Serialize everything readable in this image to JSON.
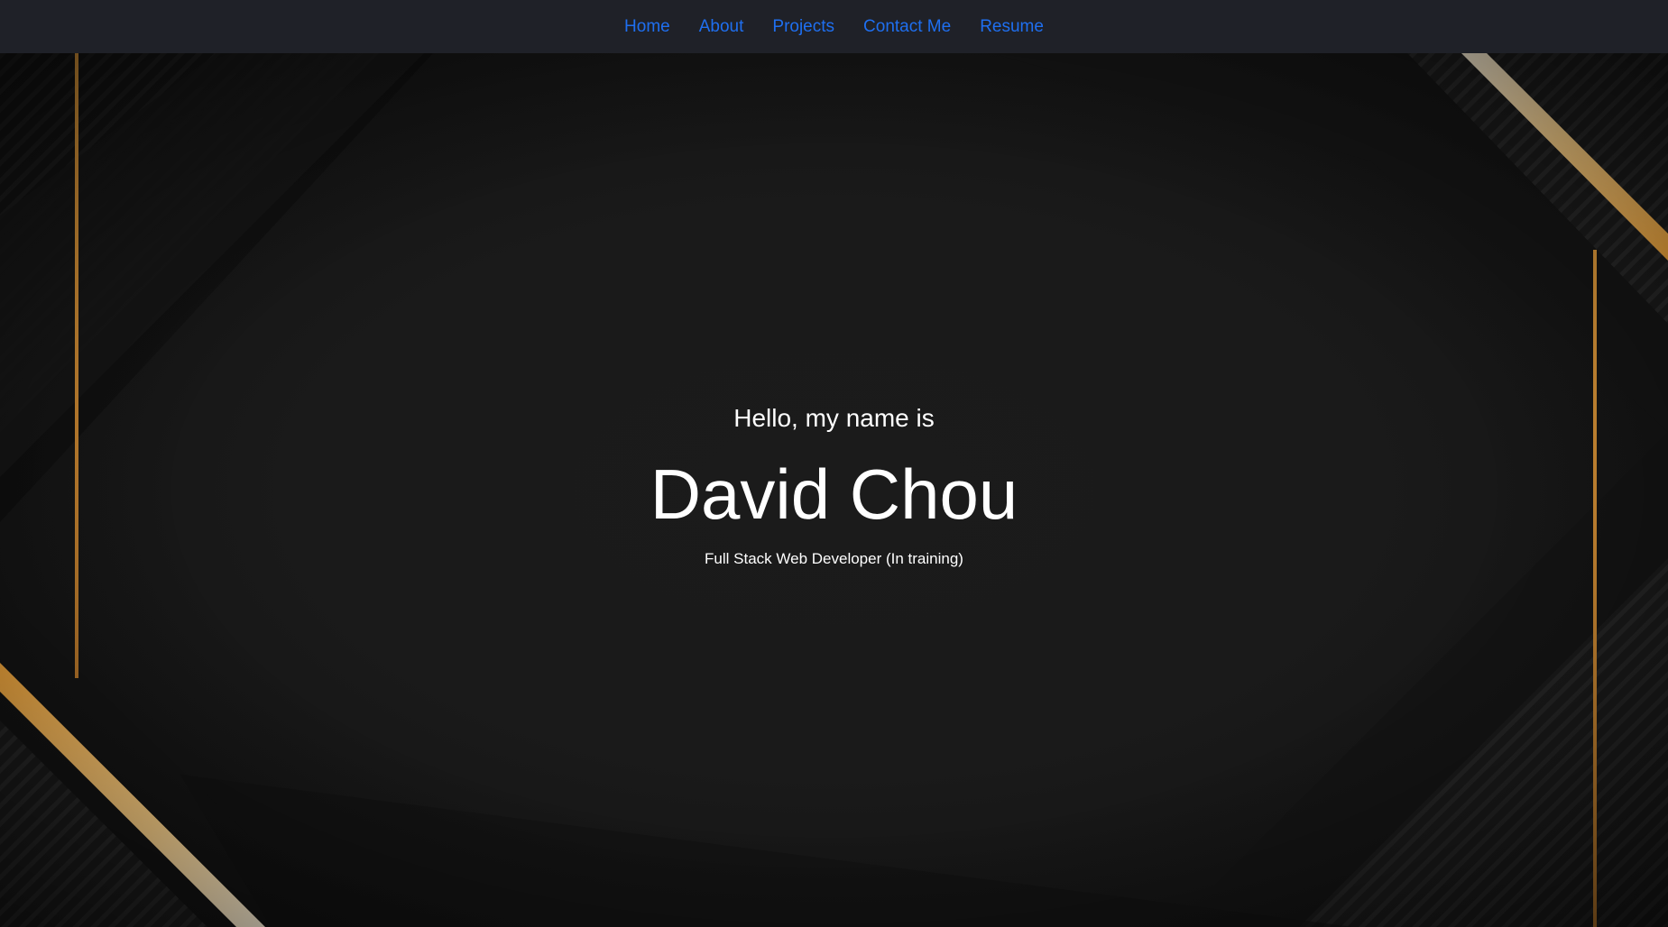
{
  "nav": {
    "items": [
      {
        "label": "Home"
      },
      {
        "label": "About"
      },
      {
        "label": "Projects"
      },
      {
        "label": "Contact Me"
      },
      {
        "label": "Resume"
      }
    ]
  },
  "hero": {
    "greeting": "Hello, my name is",
    "name": "David Chou",
    "tagline": "Full Stack Web Developer (In training)"
  },
  "colors": {
    "nav_background": "#1f2128",
    "nav_link": "#1f6ff0",
    "hero_background": "#1a1a1a",
    "accent_gold": "#f6b24a",
    "text": "#ffffff"
  }
}
